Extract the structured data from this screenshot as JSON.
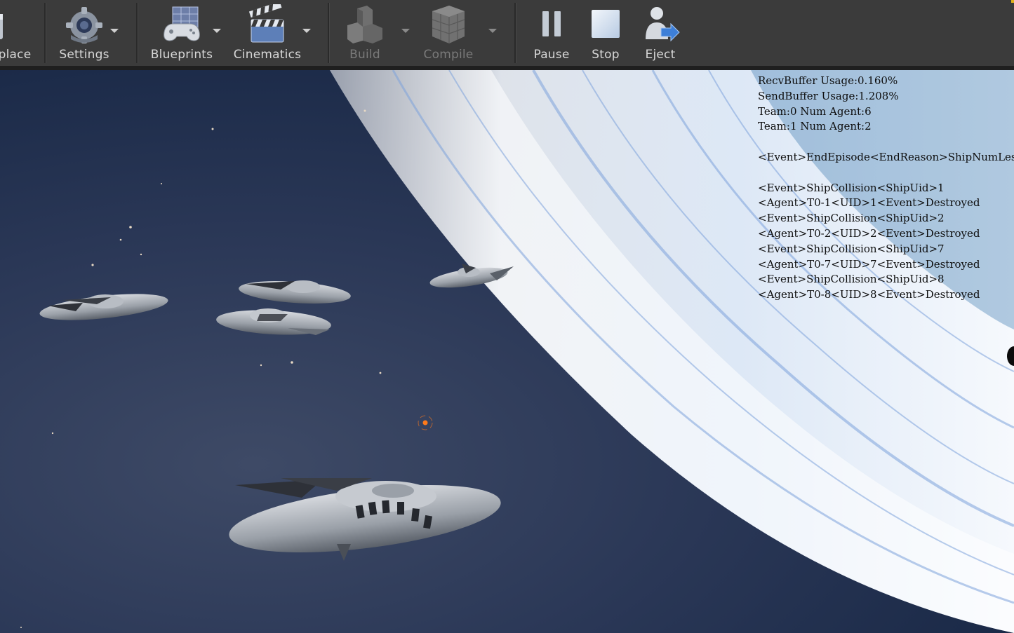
{
  "toolbar": {
    "buttons": [
      {
        "label": "place",
        "icon": "place-icon",
        "enabled": true
      },
      {
        "label": "Settings",
        "icon": "gear-icon",
        "enabled": true
      },
      {
        "label": "Blueprints",
        "icon": "blueprint-gamepad-icon",
        "enabled": true
      },
      {
        "label": "Cinematics",
        "icon": "clapperboard-icon",
        "enabled": true
      },
      {
        "label": "Build",
        "icon": "build-blocks-icon",
        "enabled": false
      },
      {
        "label": "Compile",
        "icon": "compile-cubes-icon",
        "enabled": false
      },
      {
        "label": "Pause",
        "icon": "pause-icon",
        "enabled": true
      },
      {
        "label": "Stop",
        "icon": "stop-icon",
        "enabled": true
      },
      {
        "label": "Eject",
        "icon": "eject-person-icon",
        "enabled": true
      }
    ]
  },
  "debug_overlay": {
    "lines": [
      "RecvBuffer Usage:0.160%",
      "SendBuffer Usage:1.208%",
      "Team:0 Num Agent:6",
      "Team:1 Num Agent:2",
      "",
      "<Event>EndEpisode<EndReason>ShipNumLes",
      "",
      "<Event>ShipCollision<ShipUid>1",
      "<Agent>T0-1<UID>1<Event>Destroyed",
      "<Event>ShipCollision<ShipUid>2",
      "<Agent>T0-2<UID>2<Event>Destroyed",
      "<Event>ShipCollision<ShipUid>7",
      "<Agent>T0-7<UID>7<Event>Destroyed",
      "<Event>ShipCollision<ShipUid>8",
      "<Agent>T0-8<UID>8<Event>Destroyed"
    ]
  },
  "colors": {
    "toolbar_bg": "#3b3b3b",
    "toolbar_text": "#d8d8d8",
    "disabled_text": "#7a7a7a",
    "accent": "#e3b21c",
    "crosshair": "#ff7a1a"
  }
}
